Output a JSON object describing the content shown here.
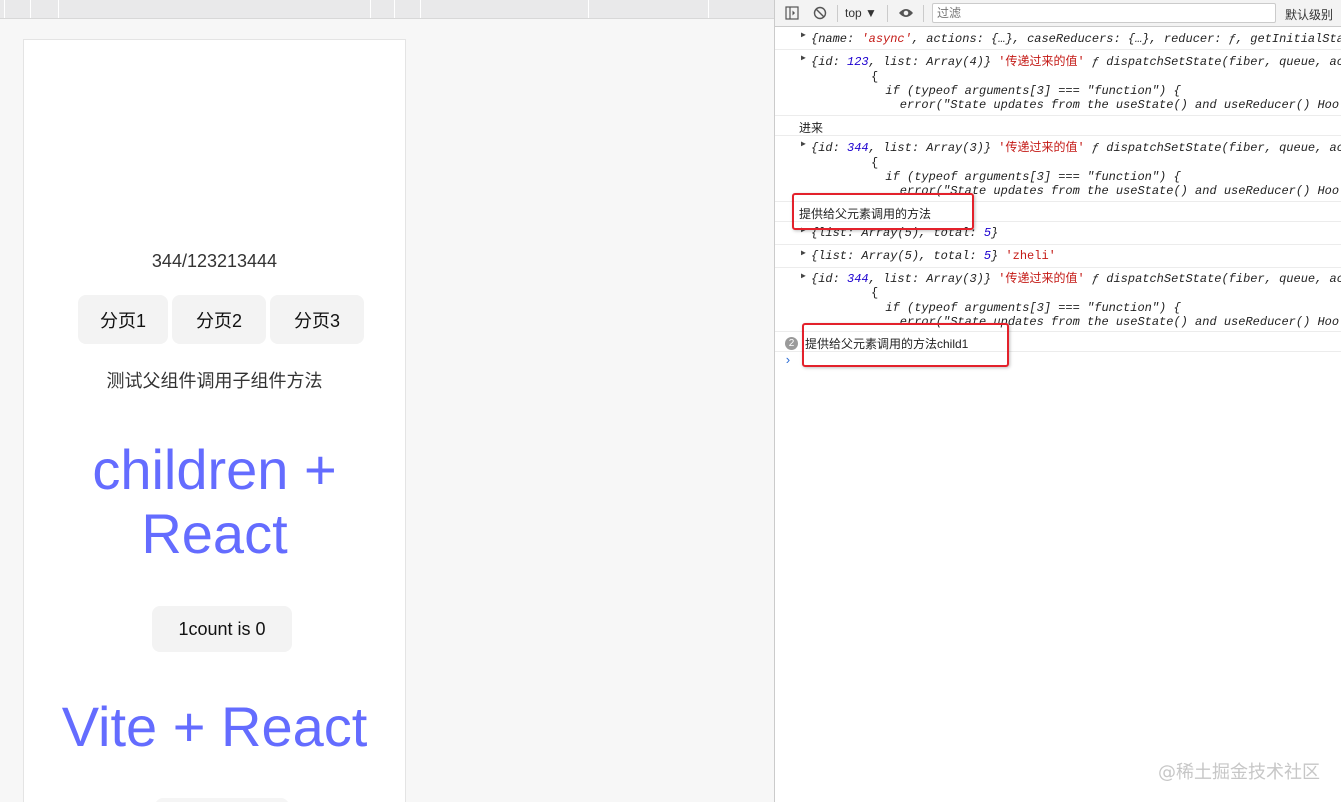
{
  "app": {
    "count_text": "344/123213444",
    "pager": [
      "分页1",
      "分页2",
      "分页3"
    ],
    "test_text": "测试父组件调用子组件方法",
    "heading1_line1": "children +",
    "heading1_line2": "React",
    "count_button": "1count is 0",
    "heading2": "Vite + React",
    "accent_color": "#646cff"
  },
  "devtools": {
    "toolbar": {
      "sidebar_icon": "sidebar-toggle-icon",
      "clear_icon": "clear-console-icon",
      "context": "top ▼",
      "eye_icon": "live-expression-eye-icon",
      "filter_placeholder": "过滤",
      "level": "默认级别"
    },
    "log": {
      "row1": {
        "open": "{",
        "k1": "name",
        "v1": "'async'",
        "rest": ", actions: {…}, caseReducers: {…}, reducer: ƒ, getInitialSta"
      },
      "row2": {
        "open": "{",
        "k1": "id",
        "v1": "123",
        "mid": ", list: Array(4)}",
        "str": "'传递过来的值'",
        "fn": "ƒ dispatchSetState(fiber, queue, ac",
        "l2": "{",
        "l3": "  if (typeof arguments[3] === \"function\") {",
        "l4": "    error(\"State updates from the useState() and useReducer() Hoo"
      },
      "row3": {
        "text": "进来"
      },
      "row4": {
        "open": "{",
        "k1": "id",
        "v1": "344",
        "mid": ", list: Array(3)}",
        "str": "'传递过来的值'",
        "fn": "ƒ dispatchSetState(fiber, queue, ac",
        "l2": "{",
        "l3": "  if (typeof arguments[3] === \"function\") {",
        "l4": "    error(\"State updates from the useState() and useReducer() Hoo"
      },
      "row5": {
        "text": "提供给父元素调用的方法"
      },
      "row6": {
        "open": "{list: Array(5), total: ",
        "total": "5",
        "close": "}"
      },
      "row7": {
        "open": "{list: Array(5), total: ",
        "total": "5",
        "close": "}",
        "str": "'zheli'"
      },
      "row8": {
        "open": "{",
        "k1": "id",
        "v1": "344",
        "mid": ", list: Array(3)}",
        "str": "'传递过来的值'",
        "fn": "ƒ dispatchSetState(fiber, queue, ac",
        "l2": "{",
        "l3": "  if (typeof arguments[3] === \"function\") {",
        "l4": "    error(\"State updates from the useState() and useReducer() Hoo"
      },
      "row9": {
        "count": "2",
        "text": "提供给父元素调用的方法child1"
      },
      "prompt": "›"
    },
    "highlight_color": "#e3212b"
  },
  "watermark": "@稀土掘金技术社区"
}
